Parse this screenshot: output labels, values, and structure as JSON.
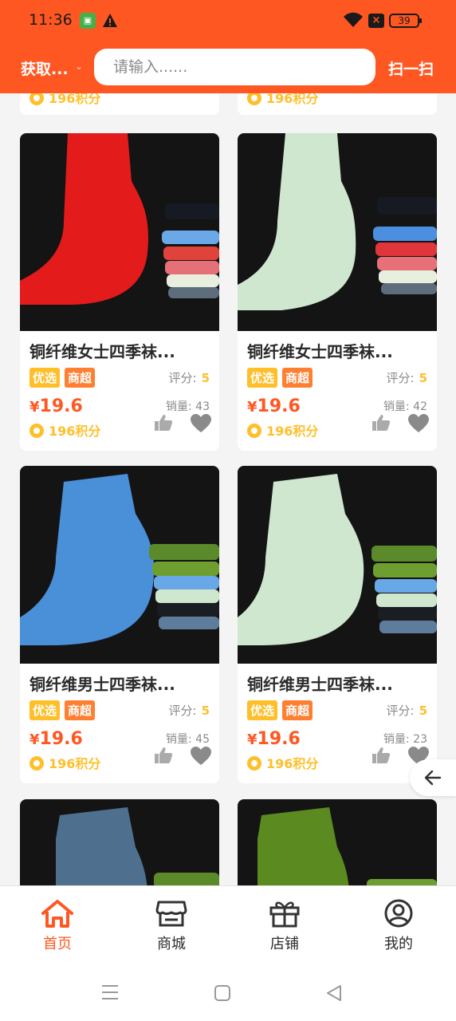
{
  "status": {
    "time": "11:36",
    "battery": "39"
  },
  "header": {
    "location": "获取...",
    "search_placeholder": "请输入......",
    "scan": "扫一扫"
  },
  "partial_cards": [
    {
      "points": "196积分"
    },
    {
      "points": "196积分"
    }
  ],
  "products": [
    {
      "title": "铜纤维女士四季袜...",
      "tag1": "优选",
      "tag2": "商超",
      "rating_label": "评分:",
      "rating": "5",
      "yen": "¥",
      "price": "19.6",
      "sales": "销量: 43",
      "points": "196积分",
      "sock_color": "#e31b1b"
    },
    {
      "title": "铜纤维女士四季袜...",
      "tag1": "优选",
      "tag2": "商超",
      "rating_label": "评分:",
      "rating": "5",
      "yen": "¥",
      "price": "19.6",
      "sales": "销量: 42",
      "points": "196积分",
      "sock_color": "#cfe6cf"
    },
    {
      "title": "铜纤维男士四季袜...",
      "tag1": "优选",
      "tag2": "商超",
      "rating_label": "评分:",
      "rating": "5",
      "yen": "¥",
      "price": "19.6",
      "sales": "销量: 45",
      "points": "196积分",
      "sock_color": "#4a90d9"
    },
    {
      "title": "铜纤维男士四季袜...",
      "tag1": "优选",
      "tag2": "商超",
      "rating_label": "评分:",
      "rating": "5",
      "yen": "¥",
      "price": "19.6",
      "sales": "销量: 23",
      "points": "196积分",
      "sock_color": "#cfe6cf"
    }
  ],
  "tabs": [
    {
      "label": "首页",
      "icon": "home-icon",
      "active": true
    },
    {
      "label": "商城",
      "icon": "store-icon",
      "active": false
    },
    {
      "label": "店铺",
      "icon": "gift-icon",
      "active": false
    },
    {
      "label": "我的",
      "icon": "user-icon",
      "active": false
    }
  ],
  "colors": {
    "accent": "#ff5722",
    "gold": "#ffbf2a",
    "tag_orange": "#ff7f32"
  }
}
